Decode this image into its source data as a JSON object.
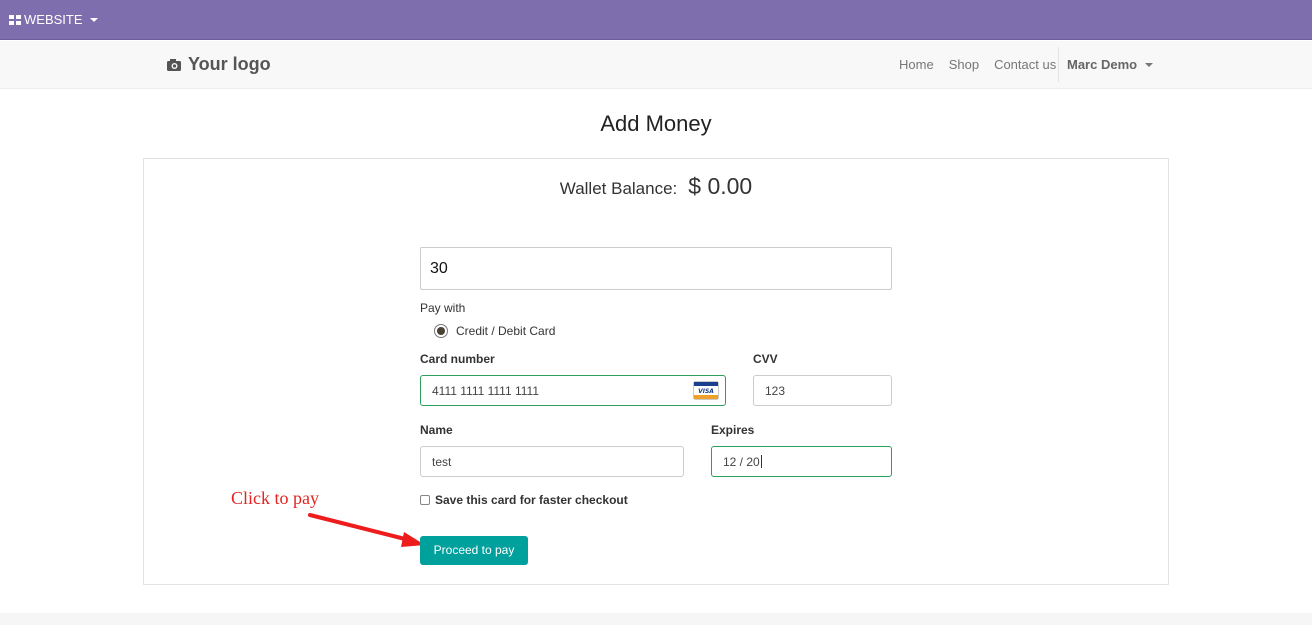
{
  "topbar": {
    "website_label": "WEBSITE",
    "background": "#7f6ead"
  },
  "navbar": {
    "logo_text": "Your logo",
    "links": [
      "Home",
      "Shop",
      "Contact us"
    ],
    "user_label": "Marc Demo"
  },
  "page": {
    "title": "Add Money"
  },
  "wallet": {
    "balance_label": "Wallet Balance:",
    "balance_value": "$ 0.00"
  },
  "form": {
    "amount_value": "30",
    "pay_with_label": "Pay with",
    "payment_option": "Credit / Debit Card",
    "card_number_label": "Card number",
    "card_number_value": "4111 1111 1111 1111",
    "card_brand_icon": "visa-icon",
    "cvv_label": "CVV",
    "cvv_value": "123",
    "name_label": "Name",
    "name_value": "test",
    "expires_label": "Expires",
    "expires_value": "12 / 20",
    "save_card_label": "Save this card for faster checkout",
    "submit_label": "Proceed to pay",
    "submit_color": "#00a09d"
  },
  "annotation": {
    "text": "Click to pay",
    "color": "#e32222"
  }
}
